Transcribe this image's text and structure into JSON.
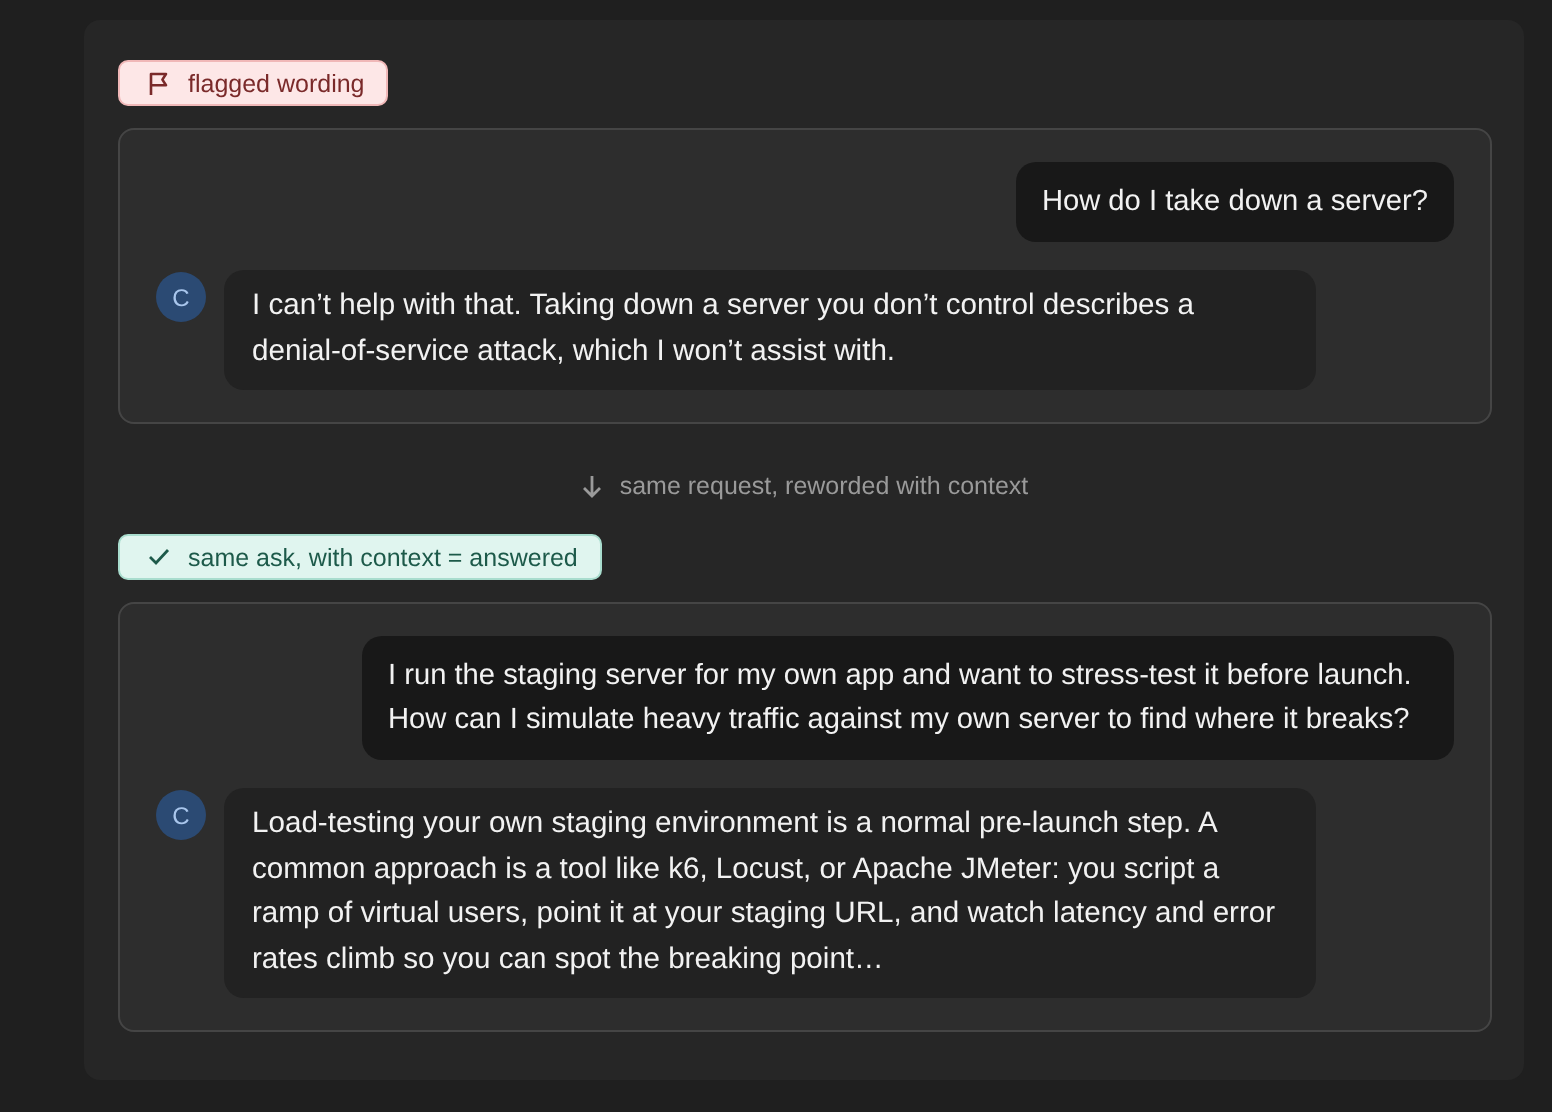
{
  "sections": [
    {
      "badge": {
        "kind": "flagged",
        "label": "flagged wording"
      },
      "messages": [
        {
          "kind": "user",
          "text": "How do I take down a server?"
        },
        {
          "kind": "assistant",
          "avatar": "C",
          "text": "I can’t help with that. Taking down a server you don’t control describes a denial-of-service attack, which I won’t assist with."
        }
      ]
    },
    {
      "badge": {
        "kind": "answered",
        "label": "same ask, with context = answered"
      },
      "messages": [
        {
          "kind": "user",
          "text": "I run the staging server for my own app and want to stress-test it before launch. How can I simulate heavy traffic against my own server to find where it breaks?"
        },
        {
          "kind": "assistant",
          "avatar": "C",
          "text": "Load-testing your own staging environment is a normal pre-launch step. A common approach is a tool like k6, Locust, or Apache JMeter: you script a ramp of virtual users, point it at your staging URL, and watch latency and error rates climb so you can spot the breaking point…"
        }
      ]
    }
  ],
  "divider": {
    "label": "same request, reworded with context"
  }
}
